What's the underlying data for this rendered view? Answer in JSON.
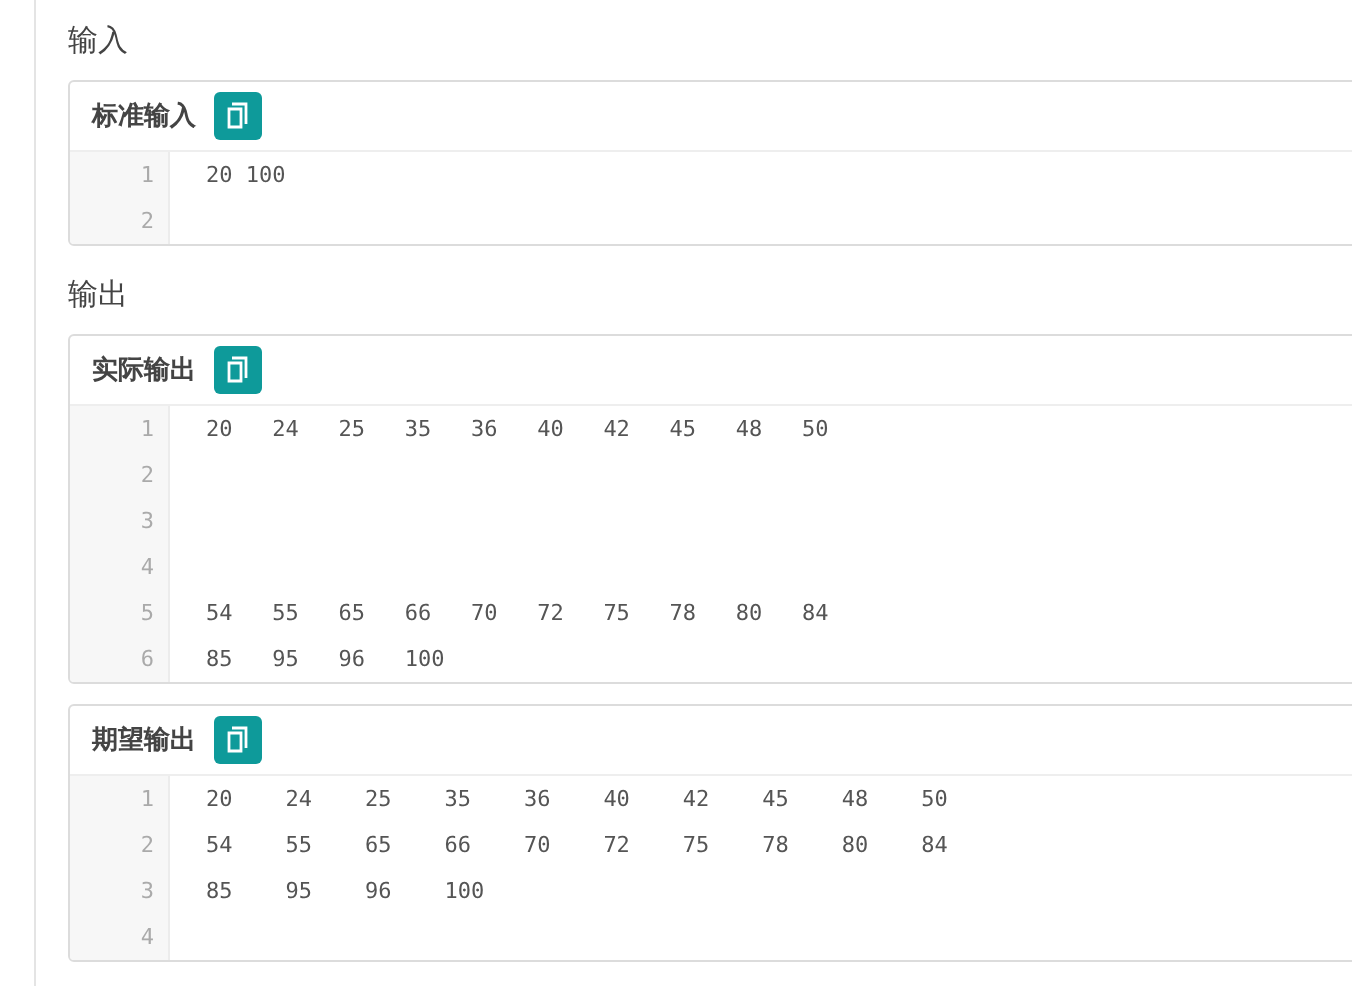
{
  "sections": [
    {
      "heading": "输入",
      "panels": [
        {
          "kind": "input",
          "title": "标准输入",
          "lines": [
            {
              "number": "1",
              "text": "20 100"
            },
            {
              "number": "2"
            }
          ]
        }
      ]
    },
    {
      "heading": "输出",
      "panels": [
        {
          "kind": "actual",
          "title": "实际输出",
          "lines": [
            {
              "number": "1",
              "text": "20\t24\t25\t35\t36\t40\t42\t45\t48\t50"
            },
            {
              "number": "2"
            },
            {
              "number": "3"
            },
            {
              "number": "4"
            },
            {
              "number": "5",
              "text": "54\t55\t65\t66\t70\t72\t75\t78\t80\t84"
            },
            {
              "number": "6",
              "text": "85\t95\t96\t100"
            }
          ]
        },
        {
          "kind": "expected",
          "title": "期望输出",
          "lines": [
            {
              "number": "1",
              "text": "20\t24\t25\t35\t36\t40\t42\t45\t48\t50"
            },
            {
              "number": "2",
              "text": "54\t55\t65\t66\t70\t72\t75\t78\t80\t84"
            },
            {
              "number": "3",
              "text": "85\t95\t96\t100"
            },
            {
              "number": "4"
            }
          ]
        }
      ]
    }
  ]
}
